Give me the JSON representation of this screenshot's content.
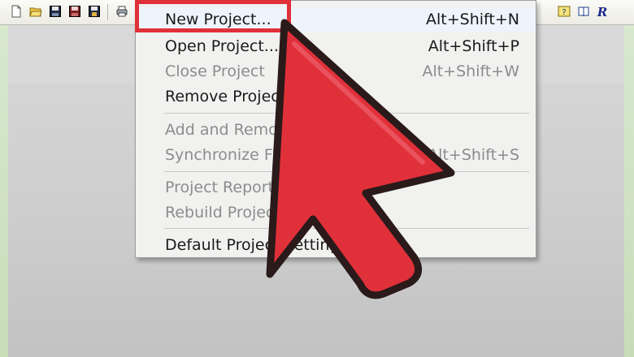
{
  "toolbar": {
    "icons": [
      "new-file-icon",
      "open-folder-icon",
      "save-icon",
      "save-all-icon",
      "save-project-icon",
      "print-icon",
      "help-icon",
      "book-icon",
      "run-icon"
    ]
  },
  "menu": {
    "items": [
      {
        "label": "New Project...",
        "shortcut": "Alt+Shift+N",
        "enabled": true,
        "highlighted": true
      },
      {
        "label": "Open Project...",
        "shortcut": "Alt+Shift+P",
        "enabled": true
      },
      {
        "label": "Close Project",
        "shortcut": "Alt+Shift+W",
        "enabled": false
      },
      {
        "label": "Remove Project",
        "shortcut": "",
        "enabled": true
      },
      {
        "label": "Add and Remov",
        "shortcut": "",
        "enabled": false
      },
      {
        "label": "Synchronize File",
        "shortcut": "Alt+Shift+S",
        "enabled": false
      },
      {
        "label": "Project Report...",
        "shortcut": "",
        "enabled": false
      },
      {
        "label": "Rebuild Project",
        "shortcut": "",
        "enabled": false
      },
      {
        "label": "Default Project Settings...",
        "shortcut": "",
        "enabled": true
      }
    ]
  },
  "colors": {
    "annotation_red": "#e0303a",
    "menu_bg": "#f1f1f0",
    "disabled_text": "#8c8c8c"
  }
}
